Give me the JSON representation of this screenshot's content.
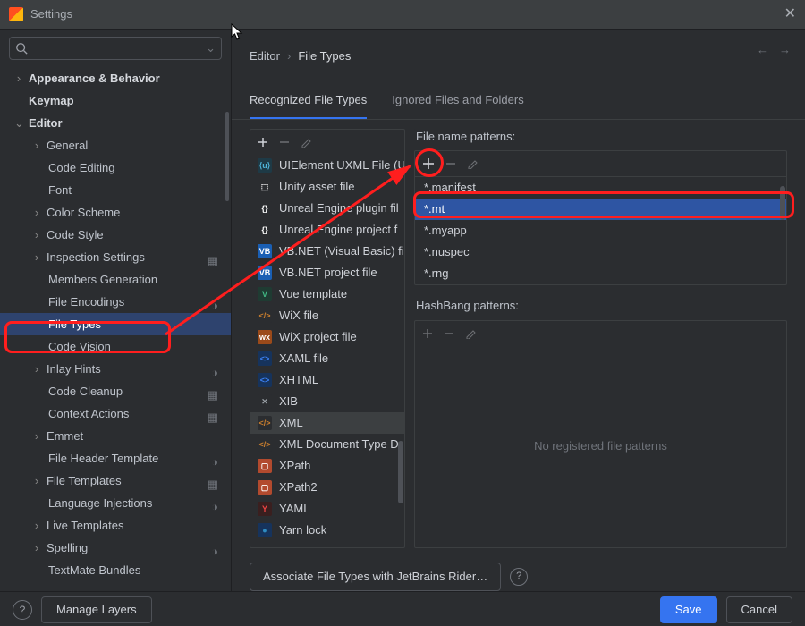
{
  "window": {
    "title": "Settings"
  },
  "search": {
    "placeholder": ""
  },
  "sidebar": {
    "items": [
      {
        "label": "Appearance & Behavior",
        "level": 0,
        "chev": "›",
        "bold": true
      },
      {
        "label": "Keymap",
        "level": 0,
        "chev": "",
        "bold": true
      },
      {
        "label": "Editor",
        "level": 0,
        "chev": "⌄",
        "bold": true
      },
      {
        "label": "General",
        "level": 1,
        "chev": "›"
      },
      {
        "label": "Code Editing",
        "level": 2,
        "chev": ""
      },
      {
        "label": "Font",
        "level": 2,
        "chev": ""
      },
      {
        "label": "Color Scheme",
        "level": 1,
        "chev": "›"
      },
      {
        "label": "Code Style",
        "level": 1,
        "chev": "›"
      },
      {
        "label": "Inspection Settings",
        "level": 1,
        "chev": "›",
        "badge": "▦"
      },
      {
        "label": "Members Generation",
        "level": 2,
        "chev": ""
      },
      {
        "label": "File Encodings",
        "level": 2,
        "chev": "",
        "badge": "◑"
      },
      {
        "label": "File Types",
        "level": 2,
        "chev": "",
        "selected": true
      },
      {
        "label": "Code Vision",
        "level": 2,
        "chev": ""
      },
      {
        "label": "Inlay Hints",
        "level": 1,
        "chev": "›",
        "badge": "◑"
      },
      {
        "label": "Code Cleanup",
        "level": 2,
        "chev": "",
        "badge": "▦"
      },
      {
        "label": "Context Actions",
        "level": 2,
        "chev": "",
        "badge": "▦"
      },
      {
        "label": "Emmet",
        "level": 1,
        "chev": "›"
      },
      {
        "label": "File Header Template",
        "level": 2,
        "chev": "",
        "badge": "◑"
      },
      {
        "label": "File Templates",
        "level": 1,
        "chev": "›",
        "badge": "▦"
      },
      {
        "label": "Language Injections",
        "level": 2,
        "chev": "",
        "badge": "◑"
      },
      {
        "label": "Live Templates",
        "level": 1,
        "chev": "›"
      },
      {
        "label": "Spelling",
        "level": 1,
        "chev": "›",
        "badge": "◑"
      },
      {
        "label": "TextMate Bundles",
        "level": 2,
        "chev": ""
      }
    ]
  },
  "breadcrumb": {
    "a": "Editor",
    "b": "File Types"
  },
  "tabs": {
    "recognized": "Recognized File Types",
    "ignored": "Ignored Files and Folders"
  },
  "filetypes": {
    "items": [
      {
        "label": "UIElement UXML File (U",
        "fg": "#4fb4d8",
        "bg": "#1e3a46",
        "txt": "⟨u⟩"
      },
      {
        "label": "Unity asset file",
        "fg": "#fff",
        "bg": "#2b2d30",
        "txt": "⬚"
      },
      {
        "label": "Unreal Engine plugin fil",
        "fg": "#fff",
        "bg": "#2b2d30",
        "txt": "{}"
      },
      {
        "label": "Unreal Engine project f",
        "fg": "#fff",
        "bg": "#2b2d30",
        "txt": "{}"
      },
      {
        "label": "VB.NET (Visual Basic) fi",
        "fg": "#fff",
        "bg": "#1a5fb4",
        "txt": "VB"
      },
      {
        "label": "VB.NET project file",
        "fg": "#fff",
        "bg": "#1a5fb4",
        "txt": "VB"
      },
      {
        "label": "Vue template",
        "fg": "#41b883",
        "bg": "#1f3b32",
        "txt": "V"
      },
      {
        "label": "WiX file",
        "fg": "#c77d2e",
        "bg": "#2b2d30",
        "txt": "</>"
      },
      {
        "label": "WiX project file",
        "fg": "#fff",
        "bg": "#9b4a1a",
        "txt": "wx"
      },
      {
        "label": "XAML file",
        "fg": "#3b82f6",
        "bg": "#16335c",
        "txt": "<>"
      },
      {
        "label": "XHTML",
        "fg": "#3b82f6",
        "bg": "#16335c",
        "txt": "<>"
      },
      {
        "label": "XIB",
        "fg": "#9aa0a6",
        "bg": "#2b2d30",
        "txt": "✕"
      },
      {
        "label": "XML",
        "fg": "#c77d2e",
        "bg": "#2b2d30",
        "txt": "</>",
        "selected": true
      },
      {
        "label": "XML Document Type D",
        "fg": "#c77d2e",
        "bg": "#2b2d30",
        "txt": "</>"
      },
      {
        "label": "XPath",
        "fg": "#fff",
        "bg": "#b24a2e",
        "txt": "▢"
      },
      {
        "label": "XPath2",
        "fg": "#fff",
        "bg": "#b24a2e",
        "txt": "▢"
      },
      {
        "label": "YAML",
        "fg": "#ef4444",
        "bg": "#3a1f1f",
        "txt": "Y"
      },
      {
        "label": "Yarn lock",
        "fg": "#2e8bc0",
        "bg": "#16335c",
        "txt": "●"
      }
    ]
  },
  "patterns": {
    "label": "File name patterns:",
    "items": [
      {
        "text": "*.manifest"
      },
      {
        "text": "*.mt",
        "selected": true
      },
      {
        "text": "*.myapp"
      },
      {
        "text": "*.nuspec"
      },
      {
        "text": "*.rng"
      }
    ]
  },
  "hashbang": {
    "label": "HashBang patterns:",
    "empty": "No registered file patterns"
  },
  "assoc": {
    "label": "Associate File Types with JetBrains Rider…"
  },
  "footer": {
    "manage": "Manage Layers",
    "save": "Save",
    "cancel": "Cancel"
  }
}
